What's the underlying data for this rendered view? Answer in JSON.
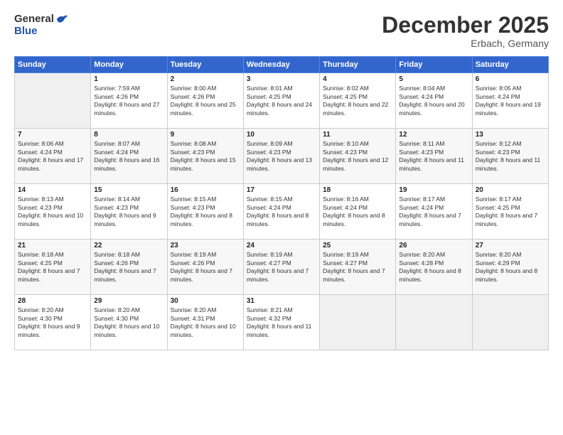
{
  "logo": {
    "general": "General",
    "blue": "Blue"
  },
  "title": {
    "month": "December 2025",
    "location": "Erbach, Germany"
  },
  "header": {
    "days": [
      "Sunday",
      "Monday",
      "Tuesday",
      "Wednesday",
      "Thursday",
      "Friday",
      "Saturday"
    ]
  },
  "weeks": [
    [
      {
        "day": "",
        "empty": true
      },
      {
        "day": "1",
        "sunrise": "7:59 AM",
        "sunset": "4:26 PM",
        "daylight": "8 hours and 27 minutes."
      },
      {
        "day": "2",
        "sunrise": "8:00 AM",
        "sunset": "4:26 PM",
        "daylight": "8 hours and 25 minutes."
      },
      {
        "day": "3",
        "sunrise": "8:01 AM",
        "sunset": "4:25 PM",
        "daylight": "8 hours and 24 minutes."
      },
      {
        "day": "4",
        "sunrise": "8:02 AM",
        "sunset": "4:25 PM",
        "daylight": "8 hours and 22 minutes."
      },
      {
        "day": "5",
        "sunrise": "8:04 AM",
        "sunset": "4:24 PM",
        "daylight": "8 hours and 20 minutes."
      },
      {
        "day": "6",
        "sunrise": "8:05 AM",
        "sunset": "4:24 PM",
        "daylight": "8 hours and 19 minutes."
      }
    ],
    [
      {
        "day": "7",
        "sunrise": "8:06 AM",
        "sunset": "4:24 PM",
        "daylight": "8 hours and 17 minutes."
      },
      {
        "day": "8",
        "sunrise": "8:07 AM",
        "sunset": "4:24 PM",
        "daylight": "8 hours and 16 minutes."
      },
      {
        "day": "9",
        "sunrise": "8:08 AM",
        "sunset": "4:23 PM",
        "daylight": "8 hours and 15 minutes."
      },
      {
        "day": "10",
        "sunrise": "8:09 AM",
        "sunset": "4:23 PM",
        "daylight": "8 hours and 13 minutes."
      },
      {
        "day": "11",
        "sunrise": "8:10 AM",
        "sunset": "4:23 PM",
        "daylight": "8 hours and 12 minutes."
      },
      {
        "day": "12",
        "sunrise": "8:11 AM",
        "sunset": "4:23 PM",
        "daylight": "8 hours and 11 minutes."
      },
      {
        "day": "13",
        "sunrise": "8:12 AM",
        "sunset": "4:23 PM",
        "daylight": "8 hours and 11 minutes."
      }
    ],
    [
      {
        "day": "14",
        "sunrise": "8:13 AM",
        "sunset": "4:23 PM",
        "daylight": "8 hours and 10 minutes."
      },
      {
        "day": "15",
        "sunrise": "8:14 AM",
        "sunset": "4:23 PM",
        "daylight": "8 hours and 9 minutes."
      },
      {
        "day": "16",
        "sunrise": "8:15 AM",
        "sunset": "4:23 PM",
        "daylight": "8 hours and 8 minutes."
      },
      {
        "day": "17",
        "sunrise": "8:15 AM",
        "sunset": "4:24 PM",
        "daylight": "8 hours and 8 minutes."
      },
      {
        "day": "18",
        "sunrise": "8:16 AM",
        "sunset": "4:24 PM",
        "daylight": "8 hours and 8 minutes."
      },
      {
        "day": "19",
        "sunrise": "8:17 AM",
        "sunset": "4:24 PM",
        "daylight": "8 hours and 7 minutes."
      },
      {
        "day": "20",
        "sunrise": "8:17 AM",
        "sunset": "4:25 PM",
        "daylight": "8 hours and 7 minutes."
      }
    ],
    [
      {
        "day": "21",
        "sunrise": "8:18 AM",
        "sunset": "4:25 PM",
        "daylight": "8 hours and 7 minutes."
      },
      {
        "day": "22",
        "sunrise": "8:18 AM",
        "sunset": "4:26 PM",
        "daylight": "8 hours and 7 minutes."
      },
      {
        "day": "23",
        "sunrise": "8:19 AM",
        "sunset": "4:26 PM",
        "daylight": "8 hours and 7 minutes."
      },
      {
        "day": "24",
        "sunrise": "8:19 AM",
        "sunset": "4:27 PM",
        "daylight": "8 hours and 7 minutes."
      },
      {
        "day": "25",
        "sunrise": "8:19 AM",
        "sunset": "4:27 PM",
        "daylight": "8 hours and 7 minutes."
      },
      {
        "day": "26",
        "sunrise": "8:20 AM",
        "sunset": "4:28 PM",
        "daylight": "8 hours and 8 minutes."
      },
      {
        "day": "27",
        "sunrise": "8:20 AM",
        "sunset": "4:29 PM",
        "daylight": "8 hours and 8 minutes."
      }
    ],
    [
      {
        "day": "28",
        "sunrise": "8:20 AM",
        "sunset": "4:30 PM",
        "daylight": "8 hours and 9 minutes."
      },
      {
        "day": "29",
        "sunrise": "8:20 AM",
        "sunset": "4:30 PM",
        "daylight": "8 hours and 10 minutes."
      },
      {
        "day": "30",
        "sunrise": "8:20 AM",
        "sunset": "4:31 PM",
        "daylight": "8 hours and 10 minutes."
      },
      {
        "day": "31",
        "sunrise": "8:21 AM",
        "sunset": "4:32 PM",
        "daylight": "8 hours and 11 minutes."
      },
      {
        "day": "",
        "empty": true
      },
      {
        "day": "",
        "empty": true
      },
      {
        "day": "",
        "empty": true
      }
    ]
  ]
}
